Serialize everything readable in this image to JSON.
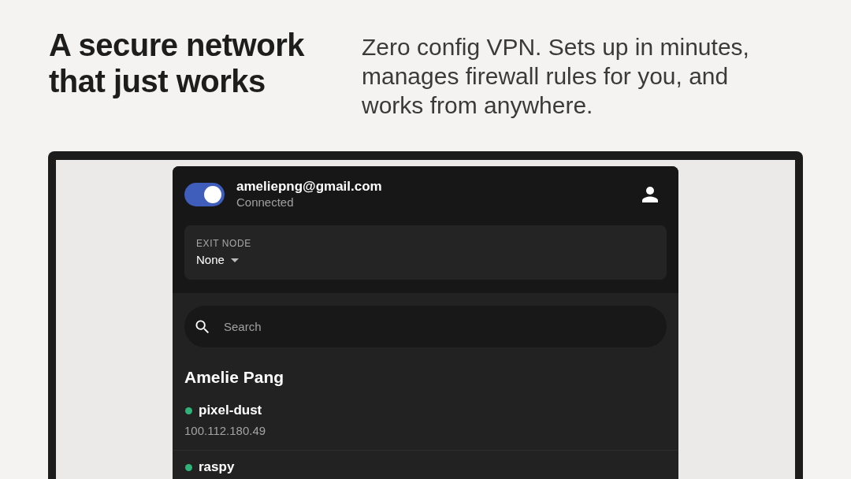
{
  "headline": "A secure network that just works",
  "description": "Zero config VPN. Sets up in minutes, manages firewall rules for you, and works from anywhere.",
  "app": {
    "connection": {
      "on": true,
      "account": "ameliepng@gmail.com",
      "status": "Connected"
    },
    "exit_node": {
      "label": "EXIT NODE",
      "value": "None"
    },
    "search": {
      "placeholder": "Search"
    },
    "users": [
      {
        "name": "Amelie Pang",
        "devices": [
          {
            "name": "pixel-dust",
            "address": "100.112.180.49",
            "online": true
          },
          {
            "name": "raspy",
            "online": true
          }
        ]
      }
    ]
  }
}
